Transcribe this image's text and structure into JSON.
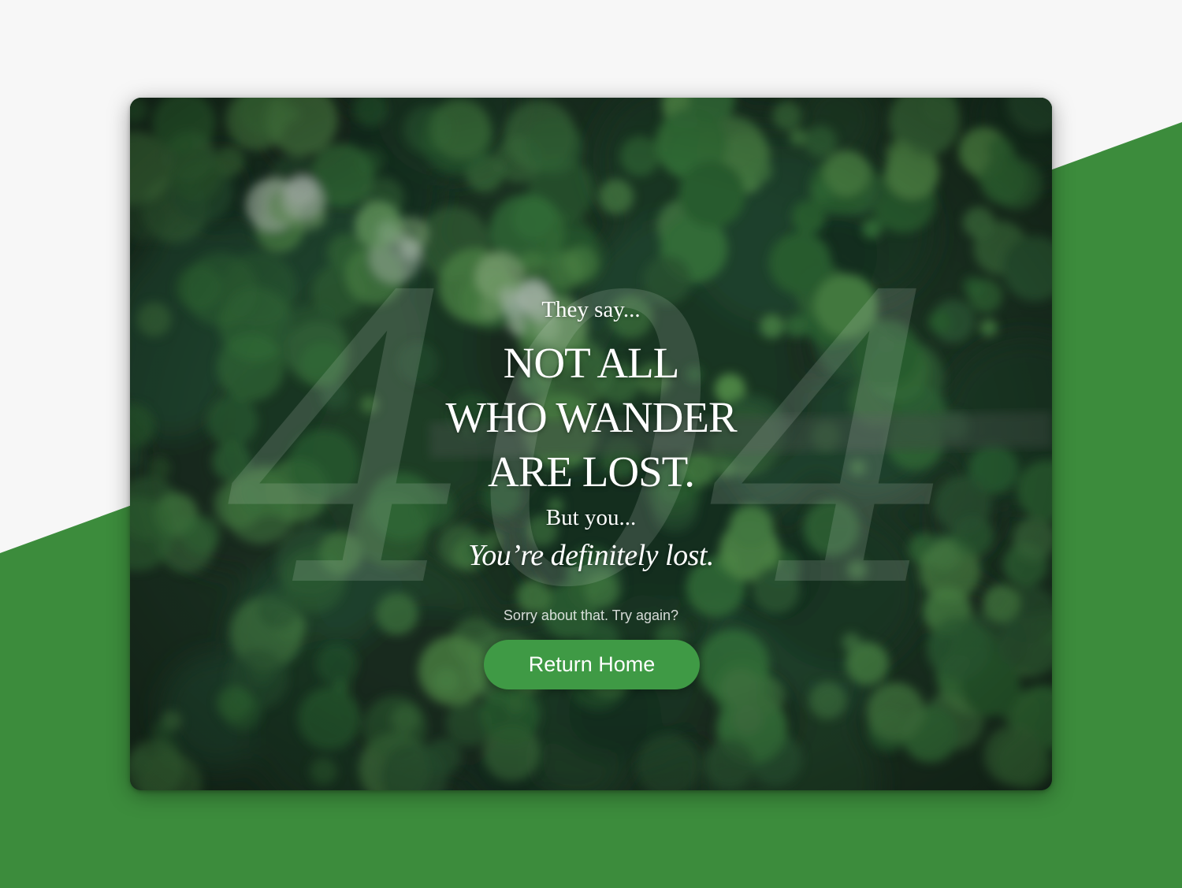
{
  "page": {
    "background_light": "#f7f7f7",
    "background_green": "#3c8c3c",
    "accent": "#3f9a45"
  },
  "card": {
    "watermark": "404",
    "eyebrow": "They say...",
    "headline": [
      "NOT ALL",
      "WHO WANDER",
      "ARE LOST."
    ],
    "but_you": "But you...",
    "lost": "You’re definitely lost.",
    "sorry": "Sorry about that. Try again?",
    "button_label": "Return Home",
    "photo": "aerial-forest-photo"
  }
}
